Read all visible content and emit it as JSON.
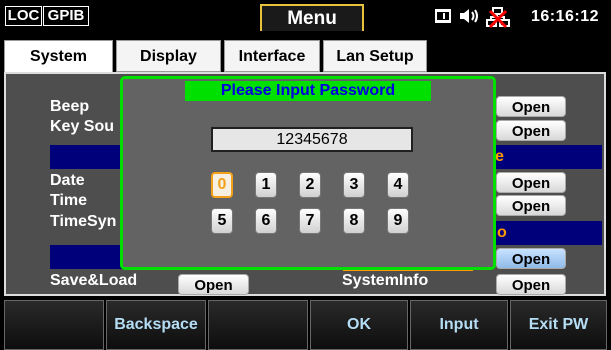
{
  "status_bar": {
    "loc": "LOC",
    "gpib": "GPIB",
    "menu_title": "Menu",
    "time": "16:16:12",
    "icons": [
      "terminal-icon",
      "speaker-icon",
      "network-disconnected-icon"
    ]
  },
  "tabs": [
    {
      "label": "System",
      "active": true
    },
    {
      "label": "Display",
      "active": false
    },
    {
      "label": "Interface",
      "active": false
    },
    {
      "label": "Lan Setup",
      "active": false
    }
  ],
  "system_rows": {
    "beep": "Beep",
    "key_sound": "Key Sou",
    "date": "Date",
    "time": "Time",
    "time_sync": "TimeSyn",
    "save_load": "Save&Load",
    "system_info": "SystemInfo"
  },
  "open_buttons": [
    "Open",
    "Open",
    "Open",
    "Open",
    "Open",
    "Open",
    "Open",
    "Open",
    "Open"
  ],
  "right_fragments": {
    "e": "e",
    "o": "o"
  },
  "password_dialog": {
    "title": "Please Input Password",
    "value": "12345678",
    "keys_row1": [
      "0",
      "1",
      "2",
      "3",
      "4"
    ],
    "keys_row2": [
      "5",
      "6",
      "7",
      "8",
      "9"
    ],
    "focused_key": "0"
  },
  "softkeys": [
    "",
    "Backspace",
    "",
    "OK",
    "Input",
    "Exit PW"
  ],
  "colors": {
    "dialog_border": "#00e000",
    "title_text": "#0000e0",
    "focus": "#f3a01a",
    "softkey_text": "#b5ddf4",
    "accent_orange": "#ff9b00",
    "navy": "#00007a"
  }
}
